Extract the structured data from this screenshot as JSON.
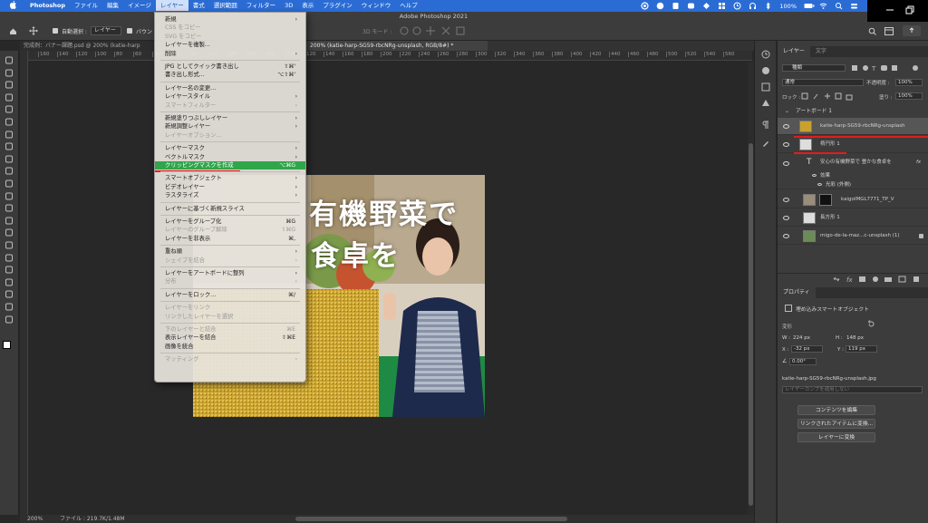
{
  "menubar": {
    "app_name": "Photoshop",
    "items": [
      "ファイル",
      "編集",
      "イメージ",
      "レイヤー",
      "書式",
      "選択範囲",
      "フィルター",
      "3D",
      "表示",
      "プラグイン",
      "ウィンドウ",
      "ヘルプ"
    ],
    "active_item": "レイヤー",
    "battery": "100%",
    "accent": "#2b6cd4"
  },
  "window": {
    "title": "Adobe Photoshop 2021"
  },
  "options": {
    "auto_select_label": "自動選択 :",
    "auto_select_value": "レイヤー",
    "bounding_label": "バウン",
    "mode_3d": "3D モード :"
  },
  "tabs": [
    {
      "label": "完成例：バナー課題.psd @ 200% (katie-harp",
      "active": false
    },
    {
      "label": "200% (katie-harp-SG59-rbcNRg-unsplash, RGB/8#) *",
      "active": true
    }
  ],
  "ruler": {
    "h": [
      "160",
      "140",
      "120",
      "100",
      "80",
      "60",
      "40",
      "20",
      "0",
      "20",
      "40",
      "60",
      "80",
      "100",
      "120",
      "140",
      "160",
      "180",
      "200",
      "220",
      "240",
      "260",
      "280",
      "300",
      "320",
      "340",
      "360",
      "380",
      "400",
      "420",
      "440",
      "460",
      "480",
      "500",
      "520",
      "540",
      "560"
    ]
  },
  "status": {
    "zoom": "200%",
    "file_info": "ファイル : 219.7K/1.48M"
  },
  "artwork": {
    "line1": "有機野菜で",
    "line2": "食卓を"
  },
  "layer_menu": {
    "items": [
      {
        "label": "新規",
        "submenu": true
      },
      {
        "label": "CSS をコピー",
        "disabled": true
      },
      {
        "label": "SVG をコピー",
        "disabled": true
      },
      {
        "label": "レイヤーを複製..."
      },
      {
        "label": "削除",
        "submenu": true
      },
      {
        "sep": true
      },
      {
        "label": "JPG としてクイック書き出し",
        "shortcut": "⇧⌘'"
      },
      {
        "label": "書き出し形式...",
        "shortcut": "⌥⇧⌘'"
      },
      {
        "sep": true
      },
      {
        "label": "レイヤー名の変更..."
      },
      {
        "label": "レイヤースタイル",
        "submenu": true
      },
      {
        "label": "スマートフィルター",
        "disabled": true,
        "submenu": true
      },
      {
        "sep": true
      },
      {
        "label": "新規塗りつぶしレイヤー",
        "submenu": true
      },
      {
        "label": "新規調整レイヤー",
        "submenu": true
      },
      {
        "label": "レイヤーオプション...",
        "disabled": true
      },
      {
        "sep": true
      },
      {
        "label": "レイヤーマスク",
        "submenu": true
      },
      {
        "label": "ベクトルマスク",
        "submenu": true
      },
      {
        "label": "クリッピングマスクを作成",
        "shortcut": "⌥⌘G",
        "highlighted": true
      },
      {
        "sep": true
      },
      {
        "label": "スマートオブジェクト",
        "submenu": true
      },
      {
        "label": "ビデオレイヤー",
        "submenu": true
      },
      {
        "label": "ラスタライズ",
        "submenu": true
      },
      {
        "sep": true
      },
      {
        "label": "レイヤーに基づく新規スライス"
      },
      {
        "sep": true
      },
      {
        "label": "レイヤーをグループ化",
        "shortcut": "⌘G"
      },
      {
        "label": "レイヤーのグループ解除",
        "shortcut": "⇧⌘G",
        "disabled": true
      },
      {
        "label": "レイヤーを非表示",
        "shortcut": "⌘,"
      },
      {
        "sep": true
      },
      {
        "label": "重ね順",
        "submenu": true
      },
      {
        "label": "シェイプを結合",
        "disabled": true,
        "submenu": true
      },
      {
        "sep": true
      },
      {
        "label": "レイヤーをアートボードに整列",
        "submenu": true
      },
      {
        "label": "分布",
        "disabled": true,
        "submenu": true
      },
      {
        "sep": true
      },
      {
        "label": "レイヤーをロック...",
        "shortcut": "⌘/"
      },
      {
        "sep": true
      },
      {
        "label": "レイヤーをリンク",
        "disabled": true
      },
      {
        "label": "リンクしたレイヤーを選択",
        "disabled": true
      },
      {
        "sep": true
      },
      {
        "label": "下のレイヤーと結合",
        "shortcut": "⌘E",
        "disabled": true
      },
      {
        "label": "表示レイヤーを結合",
        "shortcut": "⇧⌘E"
      },
      {
        "label": "画像を統合"
      },
      {
        "sep": true
      },
      {
        "label": "マッティング",
        "disabled": true,
        "submenu": true
      }
    ],
    "highlight_color": "#2fa64a"
  },
  "layers_panel": {
    "tabs": [
      "レイヤー",
      "文字"
    ],
    "filter_label": "種類",
    "blend_mode": "通常",
    "opacity_label": "不透明度 :",
    "opacity_value": "100%",
    "lock_label": "ロック :",
    "fill_label": "塗り :",
    "fill_value": "100%",
    "group": "アートボード 1",
    "layers": [
      {
        "name": "katie-harp-SG59-rbcNRg-unsplash",
        "selected": true
      },
      {
        "name": "楕円形 1"
      },
      {
        "name": "安心の有機野菜で 豊かな食卓を",
        "fx": "fx"
      },
      {
        "name": "効果"
      },
      {
        "name": "光彩 (外側)"
      },
      {
        "name": "kaigoIMGL7771_TP_V"
      },
      {
        "name": "長方形 1"
      },
      {
        "name": "migo-de-la-maz...c-unsplash (1)"
      }
    ]
  },
  "properties": {
    "title": "プロパティ",
    "kind": "埋め込みスマートオブジェクト",
    "transform_label": "変形",
    "w_label": "W :",
    "w_value": "224 px",
    "h_label": "H :",
    "h_value": "148 px",
    "x_label": "X :",
    "x_value": "-32 px",
    "y_label": "Y :",
    "y_value": "119 px",
    "angle_value": "0.00°",
    "filename": "katie-harp-SG59-rbcNRg-unsplash.jpg",
    "comp_placeholder": "レイヤーカンプを適用しない",
    "buttons": [
      "コンテンツを編集",
      "リンクされたアイテムに変換...",
      "レイヤーに変換"
    ]
  },
  "colors": {
    "ui_bg": "#3c3c3c",
    "canvas_bg": "#282828",
    "annotation_red": "#e41c1c"
  }
}
